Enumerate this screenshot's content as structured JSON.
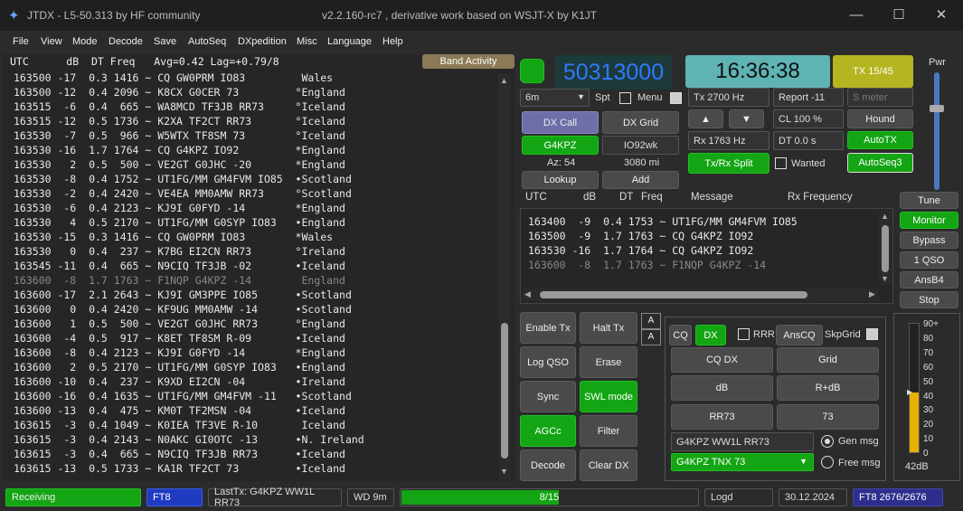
{
  "titlebar": {
    "title": "JTDX - L5-50.313  by HF community",
    "version": "v2.2.160-rc7 , derivative work based on WSJT-X by K1JT",
    "minimize": "—",
    "maximize": "☐",
    "close": "✕"
  },
  "menu": [
    "File",
    "View",
    "Mode",
    "Decode",
    "Save",
    "AutoSeq",
    "DXpedition",
    "Misc",
    "Language",
    "Help"
  ],
  "band_header": "UTC      dB  DT Freq   Avg=0.42 Lag=+0.79/8",
  "band_activity_label": "Band Activity",
  "band_lines": [
    {
      "t": "163500 -17  0.3 1416 ~ CQ GW0PRM IO83         Wales",
      "dim": false
    },
    {
      "t": "163500 -12  0.4 2096 ~ K8CX G0CER 73         °England",
      "dim": false
    },
    {
      "t": "163515  -6  0.4  665 ~ WA8MCD TF3JB RR73     °Iceland",
      "dim": false
    },
    {
      "t": "163515 -12  0.5 1736 ~ K2XA TF2CT RR73       °Iceland",
      "dim": false
    },
    {
      "t": "163530  -7  0.5  966 ~ W5WTX TF8SM 73        °Iceland",
      "dim": false
    },
    {
      "t": "163530 -16  1.7 1764 ~ CQ G4KPZ IO92         *England",
      "dim": false
    },
    {
      "t": "163530   2  0.5  500 ~ VE2GT G0JHC -20       *England",
      "dim": false
    },
    {
      "t": "163530  -8  0.4 1752 ~ UT1FG/MM GM4FVM IO85  •Scotland",
      "dim": false
    },
    {
      "t": "163530  -2  0.4 2420 ~ VE4EA MM0AMW RR73     °Scotland",
      "dim": false
    },
    {
      "t": "163530  -6  0.4 2123 ~ KJ9I G0FYD -14        *England",
      "dim": false
    },
    {
      "t": "163530   4  0.5 2170 ~ UT1FG/MM G0SYP IO83   •England",
      "dim": false
    },
    {
      "t": "163530 -15  0.3 1416 ~ CQ GW0PRM IO83        *Wales",
      "dim": false
    },
    {
      "t": "163530   0  0.4  237 ~ K7BG EI2CN RR73       °Ireland",
      "dim": false
    },
    {
      "t": "163545 -11  0.4  665 ~ N9CIQ TF3JB -02       •Iceland",
      "dim": false
    },
    {
      "t": "163600  -8  1.7 1763 ~ F1NQP G4KPZ -14        England",
      "dim": true
    },
    {
      "t": "163600 -17  2.1 2643 ~ KJ9I GM3PPE IO85      •Scotland",
      "dim": false
    },
    {
      "t": "163600   0  0.4 2420 ~ KF9UG MM0AMW -14      •Scotland",
      "dim": false
    },
    {
      "t": "163600   1  0.5  500 ~ VE2GT G0JHC RR73      °England",
      "dim": false
    },
    {
      "t": "163600  -4  0.5  917 ~ K8ET TF8SM R-09       •Iceland",
      "dim": false
    },
    {
      "t": "163600  -8  0.4 2123 ~ KJ9I G0FYD -14        *England",
      "dim": false
    },
    {
      "t": "163600   2  0.5 2170 ~ UT1FG/MM G0SYP IO83   •England",
      "dim": false
    },
    {
      "t": "163600 -10  0.4  237 ~ K9XD EI2CN -04        •Ireland",
      "dim": false
    },
    {
      "t": "163600 -16  0.4 1635 ~ UT1FG/MM GM4FVM -11   •Scotland",
      "dim": false
    },
    {
      "t": "163600 -13  0.4  475 ~ KM0T TF2MSN -04       •Iceland",
      "dim": false
    },
    {
      "t": "163615  -3  0.4 1049 ~ K0IEA TF3VE R-10       Iceland",
      "dim": false
    },
    {
      "t": "163615  -3  0.4 2143 ~ N0AKC GI0OTC -13      •N. Ireland",
      "dim": false
    },
    {
      "t": "163615  -3  0.4  665 ~ N9CIQ TF3JB RR73      •Iceland",
      "dim": false
    },
    {
      "t": "163615 -13  0.5 1733 ~ KA1R TF2CT 73         •Iceland",
      "dim": false
    }
  ],
  "freq_display": "50313000",
  "clock": "16:36:38",
  "tx_period": "TX 15/45",
  "power_label": "Pwr",
  "band_select": "6m",
  "spt_label": "Spt",
  "menu_label": "Menu",
  "tx_freq": "Tx  2700  Hz",
  "rx_freq": "Rx  1763  Hz",
  "report": "Report -11",
  "smeter_placeholder": "S meter",
  "cl": "CL  100 %",
  "dt": "DT 0.0 s",
  "hound_label": "Hound",
  "autotx_label": "AutoTX",
  "autoseq3_label": "AutoSeq3",
  "wanted_label": "Wanted",
  "dx_call_label": "DX Call",
  "dx_grid_label": "DX Grid",
  "dx_call_value": "G4KPZ",
  "dx_grid_value": "IO92wk",
  "az": "Az: 54",
  "distance": "3080 mi",
  "lookup_label": "Lookup",
  "add_label": "Add",
  "txrx_split_label": "Tx/Rx Split",
  "arrow_up": "▲",
  "arrow_down": "▼",
  "rx_header_cols": [
    "UTC",
    "dB",
    "DT",
    "Freq",
    "Message",
    "Rx Frequency"
  ],
  "rx_lines": [
    {
      "t": "163400  -9  0.4 1753 ~ UT1FG/MM GM4FVM IO85",
      "dim": false
    },
    {
      "t": "163500  -9  1.7 1763 ~ CQ G4KPZ IO92",
      "dim": false
    },
    {
      "t": "163530 -16  1.7 1764 ~ CQ G4KPZ IO92",
      "dim": false
    },
    {
      "t": "163600  -8  1.7 1763 ~ F1NQP G4KPZ -14",
      "dim": true
    }
  ],
  "side_buttons": [
    "Tune",
    "Monitor",
    "Bypass",
    "1 QSO",
    "AnsB4",
    "Stop"
  ],
  "bottom_buttons": {
    "enable_tx": "Enable Tx",
    "halt_tx": "Halt Tx",
    "log_qso": "Log QSO",
    "erase": "Erase",
    "sync": "Sync",
    "swl_mode": "SWL mode",
    "agcc": "AGCc",
    "filter": "Filter",
    "decode": "Decode",
    "clear_dx": "Clear DX"
  },
  "tab": {
    "tab_top": "A",
    "tab_bottom": "A"
  },
  "msg_panel": {
    "cq": "CQ",
    "dx": "DX",
    "rrr": "RRR",
    "anscq": "AnsCQ",
    "skpgrid": "SkpGrid",
    "cq_dx": "CQ DX",
    "grid": "Grid",
    "db": "dB",
    "r_db": "R+dB",
    "rr73": "RR73",
    "s73": "73",
    "gen_msg_text": "G4KPZ WW1L RR73",
    "gen_msg_label": "Gen msg",
    "free_msg_text": "G4KPZ TNX 73",
    "free_msg_label": "Free msg"
  },
  "meter": {
    "ticks": [
      "90+",
      "80",
      "70",
      "60",
      "50",
      "40",
      "30",
      "20",
      "10",
      "0"
    ],
    "value_label": "42dB",
    "level_db": 42,
    "max_db": 90
  },
  "status": {
    "receiving": "Receiving",
    "mode": "FT8",
    "last_tx": "LastTx: G4KPZ WW1L RR73",
    "wd": "WD 9m",
    "progress_text": "8/15",
    "progress_fraction": 0.533,
    "logd": "Logd",
    "date": "30.12.2024",
    "count": "FT8  2676/2676"
  },
  "colors": {
    "green": "#13a513",
    "freq_blue": "#2f79ff",
    "clock_teal": "#5fb3b3",
    "tx_olive": "#b5b521",
    "dx_call_purple": "#6e6ea8",
    "meter_yellow": "#e8b100"
  }
}
